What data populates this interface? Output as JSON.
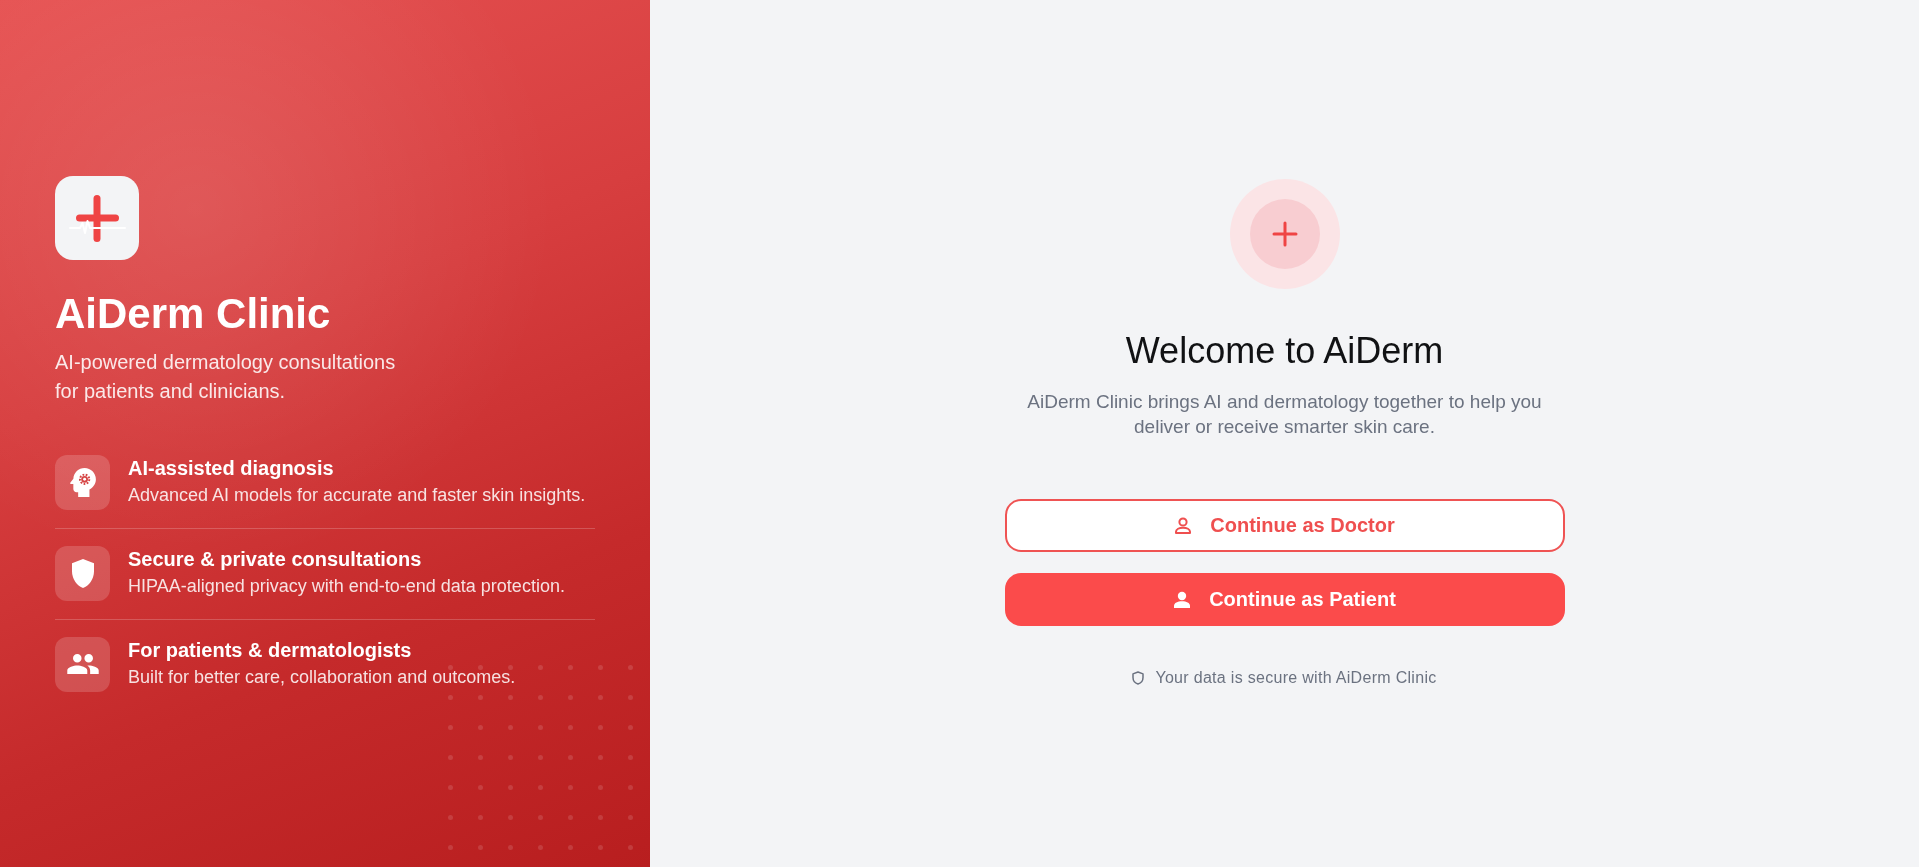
{
  "brand_panel": {
    "title": "AiDerm Clinic",
    "tagline": "AI-powered dermatology consultations for patients and clinicians.",
    "features": [
      {
        "title": "AI-assisted diagnosis",
        "description": "Advanced AI models for accurate and faster skin insights."
      },
      {
        "title": "Secure & private consultations",
        "description": "HIPAA-aligned privacy with end-to-end data protection."
      },
      {
        "title": "For patients & dermatologists",
        "description": "Built for better care, collaboration and outcomes."
      }
    ]
  },
  "welcome": {
    "title": "Welcome to AiDerm",
    "description": "AiDerm Clinic brings AI and dermatology together to help you deliver or receive smarter skin care.",
    "buttons": [
      {
        "label": "Continue as Doctor",
        "kind": "outline"
      },
      {
        "label": "Continue as Patient",
        "kind": "filled"
      }
    ],
    "security_note": "Your data is secure with AiDerm Clinic"
  }
}
